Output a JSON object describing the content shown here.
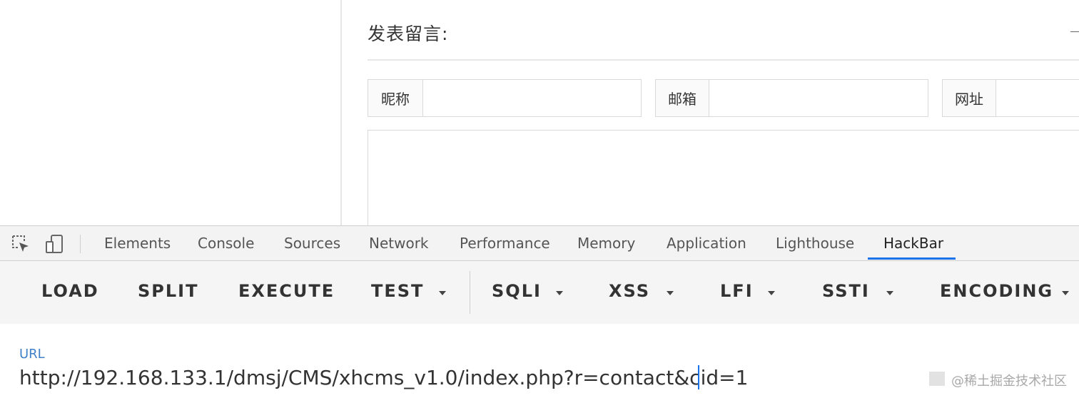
{
  "page": {
    "form_title": "发表留言:",
    "fields": {
      "nickname_label": "昵称",
      "email_label": "邮箱",
      "website_label": "网址"
    }
  },
  "devtools": {
    "tabs": [
      "Elements",
      "Console",
      "Sources",
      "Network",
      "Performance",
      "Memory",
      "Application",
      "Lighthouse",
      "HackBar"
    ],
    "active_tab": "HackBar",
    "icons": [
      "inspect-element-icon",
      "device-toolbar-icon"
    ]
  },
  "hackbar": {
    "buttons": {
      "load": "LOAD",
      "split": "SPLIT",
      "execute": "EXECUTE",
      "test": "TEST",
      "sqli": "SQLI",
      "xss": "XSS",
      "lfi": "LFI",
      "ssti": "SSTI",
      "encoding": "ENCODING"
    },
    "url_label": "URL",
    "url_value": "http://192.168.133.1/dmsj/CMS/xhcms_v1.0/index.php?r=contact&cid=1"
  },
  "watermark": "@稀土掘金技术社区",
  "colors": {
    "accent": "#1a73e8",
    "url_label": "#3f81c7",
    "toolbar_bg": "#f5f5f5"
  }
}
